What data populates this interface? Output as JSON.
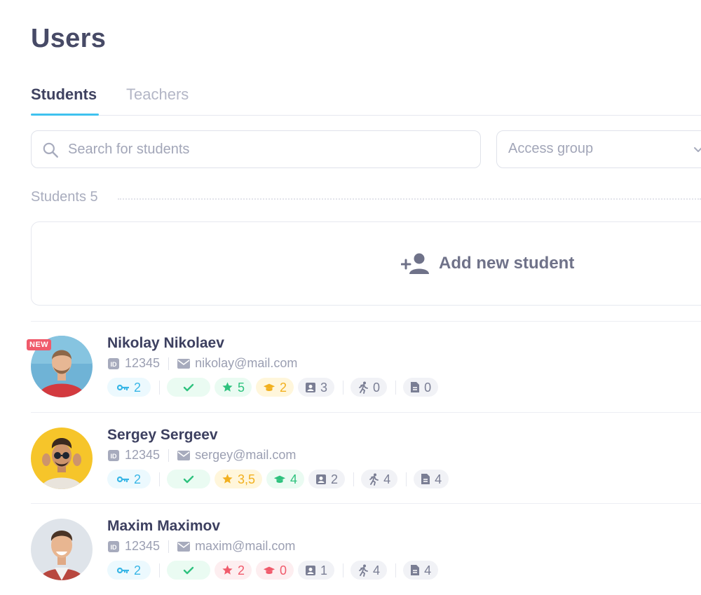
{
  "page": {
    "title": "Users"
  },
  "tabs": [
    {
      "label": "Students",
      "active": true
    },
    {
      "label": "Teachers",
      "active": false
    }
  ],
  "search": {
    "placeholder": "Search for students",
    "value": ""
  },
  "filter": {
    "selected": "Access group",
    "icon": "chevron-down-icon"
  },
  "section": {
    "label": "Students 5"
  },
  "add": {
    "label": "Add new student",
    "icon": "add-user-icon"
  },
  "colors": {
    "accent": "#3fc2ef",
    "green": "#2ec27e",
    "yellow": "#f2b01e",
    "red": "#f05a6b",
    "key": "#38b6e6",
    "badge_new": "#f05a6b"
  },
  "users": [
    {
      "name": "Nikolay Nikolaev",
      "badge": "NEW",
      "id": "12345",
      "email": "nikolay@mail.com",
      "stats": {
        "keys": "2",
        "rating": "5",
        "rating_color": "green",
        "grad": "2",
        "grad_color": "yellow",
        "cards": "3",
        "activity": "0",
        "docs": "0"
      }
    },
    {
      "name": "Sergey Sergeev",
      "badge": "",
      "id": "12345",
      "email": "sergey@mail.com",
      "stats": {
        "keys": "2",
        "rating": "3,5",
        "rating_color": "yellow",
        "grad": "4",
        "grad_color": "green",
        "cards": "2",
        "activity": "4",
        "docs": "4"
      }
    },
    {
      "name": "Maxim Maximov",
      "badge": "",
      "id": "12345",
      "email": "maxim@mail.com",
      "stats": {
        "keys": "2",
        "rating": "2",
        "rating_color": "red",
        "grad": "0",
        "grad_color": "red",
        "cards": "1",
        "activity": "4",
        "docs": "4"
      }
    }
  ]
}
